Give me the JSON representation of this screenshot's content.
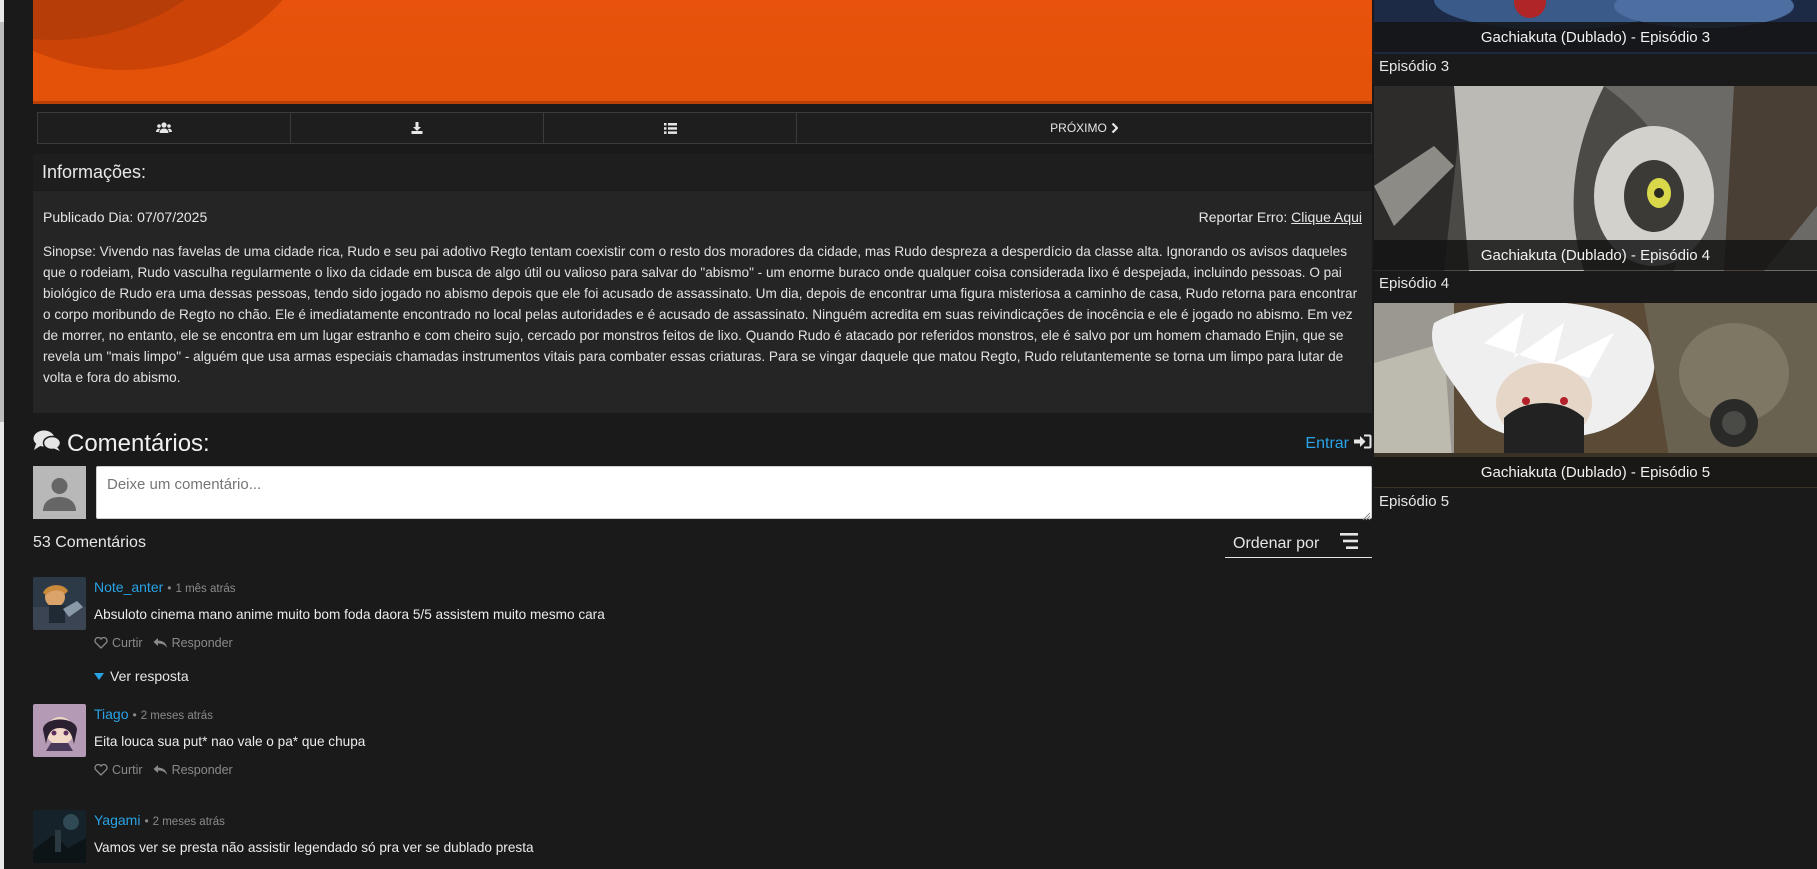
{
  "player": {
    "next_label": "PRÓXIMO"
  },
  "toolbar": {
    "icons": [
      "users-icon",
      "download-icon",
      "list-icon",
      "chevron-right-icon"
    ]
  },
  "info": {
    "heading": "Informações:",
    "published": "Publicado Dia: 07/07/2025",
    "report_prefix": "Reportar Erro:",
    "report_link": "Clique Aqui",
    "synopsis": "Sinopse: Vivendo nas favelas de uma cidade rica, Rudo e seu pai adotivo Regto tentam coexistir com o resto dos moradores da cidade, mas Rudo despreza a desperdício da classe alta. Ignorando os avisos daqueles que o rodeiam, Rudo vasculha regularmente o lixo da cidade em busca de algo útil ou valioso para salvar do \"abismo\" - um enorme buraco onde qualquer coisa considerada lixo é despejada, incluindo pessoas. O pai biológico de Rudo era uma dessas pessoas, tendo sido jogado no abismo depois que ele foi acusado de assassinato. Um dia, depois de encontrar uma figura misteriosa a caminho de casa, Rudo retorna para encontrar o corpo moribundo de Regto no chão. Ele é imediatamente encontrado no local pelas autoridades e é acusado de assassinato. Ninguém acredita em suas reivindicações de inocência e ele é jogado no abismo. Em vez de morrer, no entanto, ele se encontra em um lugar estranho e com cheiro sujo, cercado por monstros feitos de lixo. Quando Rudo é atacado por referidos monstros, ele é salvo por um homem chamado Enjin, que se revela um \"mais limpo\" - alguém que usa armas especiais chamadas instrumentos vitais para combater essas criaturas. Para se vingar daquele que matou Regto, Rudo relutantemente se torna um limpo para lutar de volta e fora do abismo."
  },
  "comments": {
    "title": "Comentários:",
    "login_label": "Entrar",
    "input_placeholder": "Deixe um comentário...",
    "count_label": "53 Comentários",
    "sort_label": "Ordenar por",
    "like_label": "Curtir",
    "reply_label": "Responder",
    "view_reply_label": "Ver resposta",
    "items": [
      {
        "user": "Note_anter",
        "time": "1 mês atrás",
        "text": "Absuloto cinema mano anime muito bom  foda daora 5/5  assistem muito mesmo cara"
      },
      {
        "user": "Tiago",
        "time": "2 meses atrás",
        "text": "Eita louca sua put* nao vale o pa* que chupa"
      },
      {
        "user": "Yagami",
        "time": "2 meses atrás",
        "text": "Vamos ver se presta não assistir legendado só pra ver se dublado presta"
      }
    ]
  },
  "sidebar": {
    "episodes": [
      {
        "caption": "Gachiakuta (Dublado) - Episódio 3",
        "label": "Episódio 3"
      },
      {
        "caption": "Gachiakuta (Dublado) - Episódio 4",
        "label": "Episódio 4"
      },
      {
        "caption": "Gachiakuta (Dublado) - Episódio 5",
        "label": "Episódio 5"
      }
    ]
  },
  "colors": {
    "accent": "#29a3e6",
    "background": "#1a1a1a",
    "panel": "#252525",
    "player_orange": "#e25208"
  }
}
